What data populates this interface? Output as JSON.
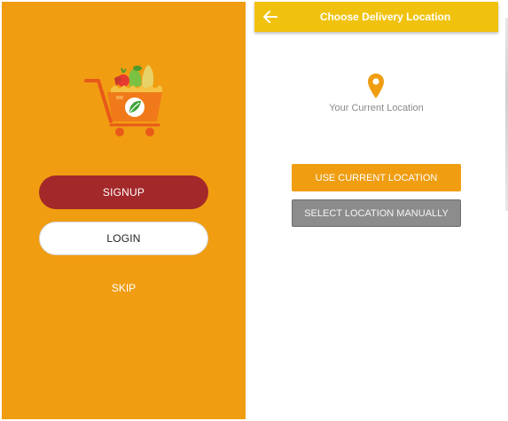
{
  "login_screen": {
    "background_color": "#F09D12",
    "logo_icon": "grocery-cart-logo",
    "signup_label": "SIGNUP",
    "login_label": "LOGIN",
    "skip_label": "SKIP",
    "colors": {
      "signup_bg": "#A3282A",
      "login_bg": "#FFFFFF"
    }
  },
  "location_screen": {
    "appbar": {
      "title": "Choose Delivery Location",
      "back_icon": "arrow-left-icon",
      "color": "#F0C20E"
    },
    "pin_icon": "location-pin-icon",
    "current_location_text": "Your Current Location",
    "use_current_label": "USE CURRENT LOCATION",
    "select_manual_label": "SELECT LOCATION MANUALLY",
    "colors": {
      "use_current_bg": "#F09D12",
      "select_manual_bg": "#8C8C8C"
    }
  }
}
